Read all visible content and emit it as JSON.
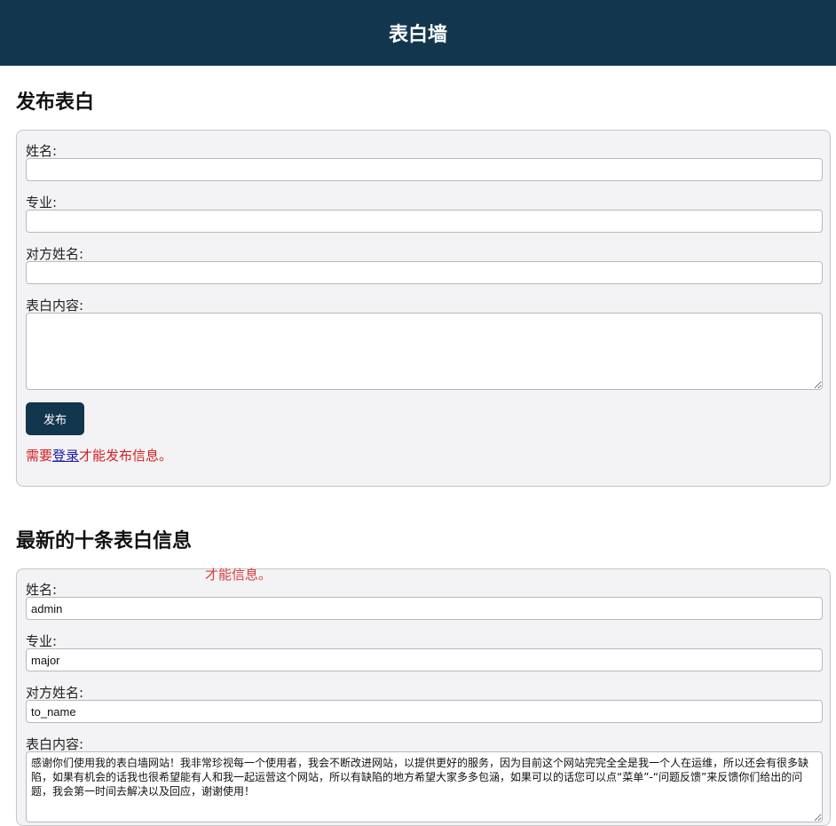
{
  "header": {
    "title": "表白墙"
  },
  "publish": {
    "heading": "发布表白",
    "name_label": "姓名:",
    "major_label": "专业:",
    "to_name_label": "对方姓名:",
    "content_label": "表白内容:",
    "name_value": "",
    "major_value": "",
    "to_name_value": "",
    "content_value": "",
    "submit_label": "发布",
    "notice_prefix": "需要",
    "login_link": "登录",
    "notice_suffix": "才能发布信息。"
  },
  "latest": {
    "heading": "最新的十条表白信息",
    "ghost_text": "才能信息。",
    "items": [
      {
        "name_label": "姓名:",
        "name": "admin",
        "major_label": "专业:",
        "major": "major",
        "to_name_label": "对方姓名:",
        "to_name": "to_name",
        "content_label": "表白内容:",
        "content": "感谢你们使用我的表白墙网站！我非常珍视每一个使用者，我会不断改进网站，以提供更好的服务，因为目前这个网站完完全全是我一个人在运维，所以还会有很多缺陷，如果有机会的话我也很希望能有人和我一起运营这个网站，所以有缺陷的地方希望大家多多包涵，如果可以的话您可以点“菜单”-“问题反馈”来反馈你们给出的问题，我会第一时间去解决以及回应，谢谢使用！"
      }
    ]
  },
  "colors": {
    "header_bg": "#12364d",
    "button_bg": "#12364d",
    "notice": "#d31f1f",
    "link": "#1a1aa6"
  }
}
